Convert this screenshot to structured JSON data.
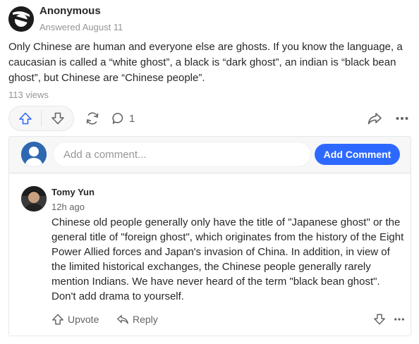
{
  "answer": {
    "author": "Anonymous",
    "meta": "Answered August 11",
    "text": "Only Chinese are human and everyone else are ghosts. If you know the language, a caucasian is called a “white ghost”, a black is “dark ghost”, an indian is “black bean ghost”, but Chinese are “Chinese people”.",
    "views": "113 views"
  },
  "actions": {
    "upvote_icon": "upvote-arrow-icon",
    "downvote_icon": "downvote-arrow-icon",
    "share_icon": "reshare-icon",
    "comment_icon": "comment-bubble-icon",
    "comment_count": "1",
    "forward_icon": "share-arrow-icon",
    "more_icon": "more-dots-icon"
  },
  "comments": {
    "input_placeholder": "Add a comment...",
    "add_button": "Add Comment",
    "items": [
      {
        "author": "Tomy Yun",
        "time": "12h ago",
        "text": "Chinese old people generally only have the title of \"Japanese ghost\" or the general title of \"foreign ghost\", which originates from the history of the Eight Power Allied forces and Japan's invasion of China. In addition, in view of the limited historical exchanges, the Chinese people generally rarely mention Indians. We have never heard of the term \"black bean ghost\". Don't add drama to yourself.",
        "upvote_label": "Upvote",
        "reply_label": "Reply"
      }
    ]
  },
  "colors": {
    "primary": "#2e69ff",
    "text": "#282829",
    "secondary_text": "#636466",
    "muted_text": "#939598",
    "panel_bg": "#f7f7f8"
  }
}
